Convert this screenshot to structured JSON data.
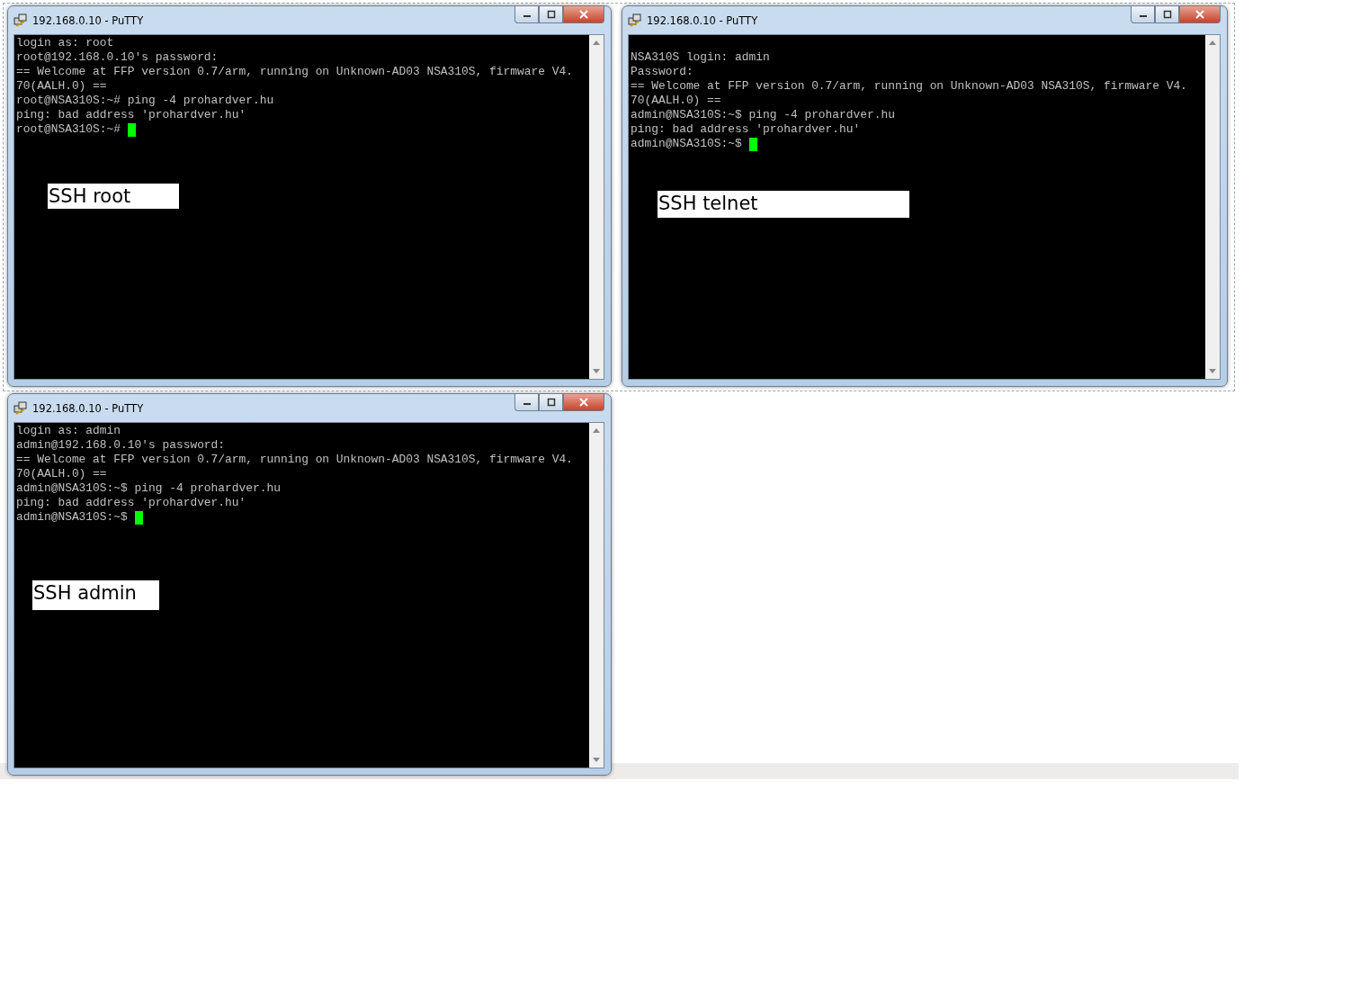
{
  "windows": [
    {
      "title": "192.168.0.10 - PuTTY",
      "leading_blank_line": false,
      "lines": [
        "login as: root",
        "root@192.168.0.10's password:",
        "== Welcome at FFP version 0.7/arm, running on Unknown-AD03 NSA310S, firmware V4.",
        "70(AALH.0) ==",
        "root@NSA310S:~# ping -4 prohardver.hu",
        "ping: bad address 'prohardver.hu'",
        "root@NSA310S:~# "
      ],
      "cursor": true,
      "label": "SSH root"
    },
    {
      "title": "192.168.0.10 - PuTTY",
      "leading_blank_line": true,
      "lines": [
        "NSA310S login: admin",
        "Password:",
        "== Welcome at FFP version 0.7/arm, running on Unknown-AD03 NSA310S, firmware V4.",
        "70(AALH.0) ==",
        "admin@NSA310S:~$ ping -4 prohardver.hu",
        "ping: bad address 'prohardver.hu'",
        "admin@NSA310S:~$ "
      ],
      "cursor": true,
      "label": "SSH telnet"
    },
    {
      "title": "192.168.0.10 - PuTTY",
      "leading_blank_line": false,
      "lines": [
        "login as: admin",
        "admin@192.168.0.10's password:",
        "== Welcome at FFP version 0.7/arm, running on Unknown-AD03 NSA310S, firmware V4.",
        "70(AALH.0) ==",
        "admin@NSA310S:~$ ping -4 prohardver.hu",
        "ping: bad address 'prohardver.hu'",
        "admin@NSA310S:~$ "
      ],
      "cursor": true,
      "label": "SSH admin"
    }
  ]
}
